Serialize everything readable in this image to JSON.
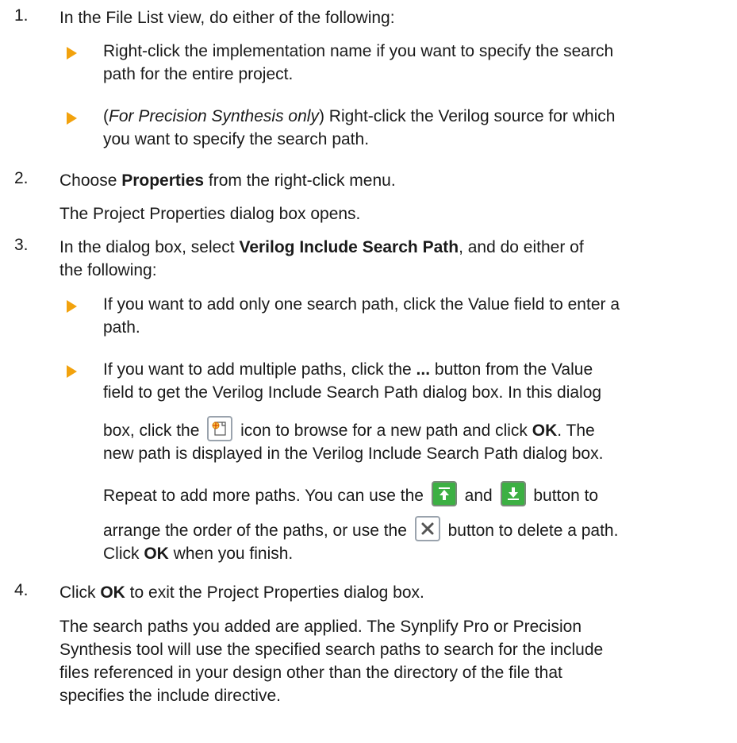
{
  "steps": [
    {
      "num": "1.",
      "text": "In the File List view, do either of the following:",
      "bullets": [
        {
          "line1": "Right-click the implementation name if you want to specify the search",
          "line2": "path for the entire project."
        },
        {
          "paren_open": "(",
          "italic": "For Precision Synthesis only",
          "rest1": ") Right-click the Verilog source for which",
          "line2": "you want to specify the search path."
        }
      ]
    },
    {
      "num": "2.",
      "pre": "Choose ",
      "bold": "Properties",
      "post": " from the right-click menu.",
      "para": "The Project Properties dialog box opens."
    },
    {
      "num": "3.",
      "pre": "In the dialog box, select ",
      "bold": "Verilog Include Search Path",
      "post1": ", and do either of",
      "line2": "the following:",
      "bullets": [
        {
          "line1": "If you want to add only one search path, click the Value field to enter a",
          "line2": "path."
        },
        {
          "l1_pre": "If you want to add multiple paths, click the ",
          "l1_bold": "...",
          "l1_post": " button from the Value",
          "line2": "field to get the Verilog Include Search Path dialog box. In this dialog",
          "l3_pre": "box, click the ",
          "l3_mid": " icon to browse for a new path and click ",
          "l3_bold": "OK",
          "l3_post": ". The",
          "line4": "new path is displayed in the Verilog Include Search Path dialog box.",
          "r1_pre": "Repeat to add more paths. You can use the ",
          "r1_and": " and ",
          "r1_post": " button to",
          "r2_pre": "arrange the order of the paths, or use the ",
          "r2_post": " button to delete a path.",
          "r3_pre": "Click ",
          "r3_bold": "OK",
          "r3_post": " when you finish."
        }
      ]
    },
    {
      "num": "4.",
      "pre": "Click ",
      "bold": "OK",
      "post": " to exit the Project Properties dialog box.",
      "para_lines": [
        "The search paths you added are applied. The Synplify Pro or Precision",
        "Synthesis tool will use the specified search paths to search for the include",
        "files referenced in your design other than the directory of the file that",
        "specifies the include directive."
      ]
    }
  ],
  "icons": {
    "new_path": "browse-new-path-icon",
    "move_up": "move-up-icon",
    "move_down": "move-down-icon",
    "delete": "delete-icon"
  },
  "colors": {
    "bullet": "#f2a20d",
    "text": "#1a1a1a",
    "icon_green": "#3cb043"
  }
}
